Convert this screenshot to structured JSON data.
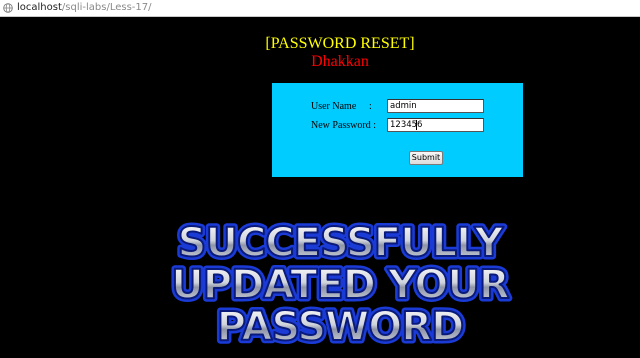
{
  "browser": {
    "url_host": "localhost",
    "url_path": "/sqli-labs/Less-17/",
    "icon": "globe-icon"
  },
  "page": {
    "title": "[PASSWORD RESET]",
    "subtitle": "Dhakkan",
    "colors": {
      "background": "#000000",
      "title": "#ffff00",
      "subtitle": "#ff0000",
      "panel": "#00ccff"
    }
  },
  "form": {
    "username_label": "User Name",
    "username_colon": ":",
    "username_value": "admin",
    "password_label": "New Password :",
    "password_value": "123456",
    "submit_label": "Submit"
  },
  "banner": {
    "lines": [
      "SUCCESSFULLY",
      "UPDATED YOUR",
      "PASSWORD"
    ]
  }
}
